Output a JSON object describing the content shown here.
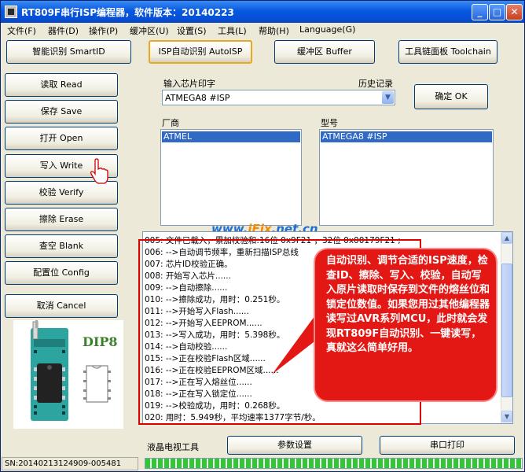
{
  "window": {
    "title": "RT809F串行ISP编程器，软件版本：20140223"
  },
  "menu": [
    "文件(F)",
    "器件(D)",
    "操作(P)",
    "缓冲区(U)",
    "设置(S)",
    "工具(L)",
    "帮助(H)",
    "Language(G)"
  ],
  "toolbar": {
    "smart_id": "智能识别 SmartID",
    "auto_isp": "ISP自动识别 AutoISP",
    "buffer": "缓冲区 Buffer",
    "toolchain": "工具链面板 Toolchain"
  },
  "actions": {
    "read": "读取 Read",
    "save": "保存 Save",
    "open": "打开 Open",
    "write": "写入 Write",
    "verify": "校验 Verify",
    "erase": "擦除 Erase",
    "blank": "查空 Blank",
    "config": "配置位 Config",
    "cancel": "取消 Cancel"
  },
  "chip_input": {
    "label": "输入芯片印字",
    "history_label": "历史记录",
    "value": "ATMEGA8 #ISP",
    "ok_label": "确定 OK"
  },
  "vendor": {
    "label": "厂商",
    "selected": "ATMEL"
  },
  "model": {
    "label": "型号",
    "selected": "ATMEGA8 #ISP"
  },
  "log": [
    "005: 文件已载入，累加校验和:16位 0x9F21 ，32位 0x00179F21 ;",
    "006: -->自动调节频率，重新扫描ISP总线",
    "007: 芯片ID校验正确。",
    "008: 开始写入芯片......",
    "009: -->自动擦除......",
    "010: -->擦除成功，用时：0.251秒。",
    "011: -->开始写入Flash......",
    "012: -->开始写入EEPROM......",
    "013: -->写入成功，用时：5.398秒。",
    "014: -->自动校验......",
    "015: -->正在校验Flash区域......",
    "016: -->正在校验EEPROM区域......",
    "017: -->正在写入熔丝位......",
    "018: -->正在写入锁定位......",
    "019: -->校验成功，用时：0.268秒。",
    "020: 用时：5.949秒，平均速率1377字节/秒。"
  ],
  "callout": {
    "text": "自动识别、调节合适的ISP速度，检查ID、擦除、写入、校验，自动写入原片读取时保存到文件的熔丝位和锁定位数值。如果您用过其他编程器读写过AVR系列MCU，此时就会发现RT809F自动识别、一键读写，真就这么简单好用。"
  },
  "watermark": {
    "prefix": "www.",
    "brand": "iFix",
    "suffix": ".net.cn"
  },
  "chip_panel": {
    "package_label": "DIP8"
  },
  "bottom": {
    "lcd_tool": "液晶电视工具",
    "params": "参数设置",
    "serial_print": "串口打印",
    "serial_number": "SN:20140213124909-005481"
  },
  "colors": {
    "title_blue": "#0858e0",
    "callout_red": "#e31814",
    "selection_blue": "#316ac5",
    "progress_green": "#2ec930"
  }
}
